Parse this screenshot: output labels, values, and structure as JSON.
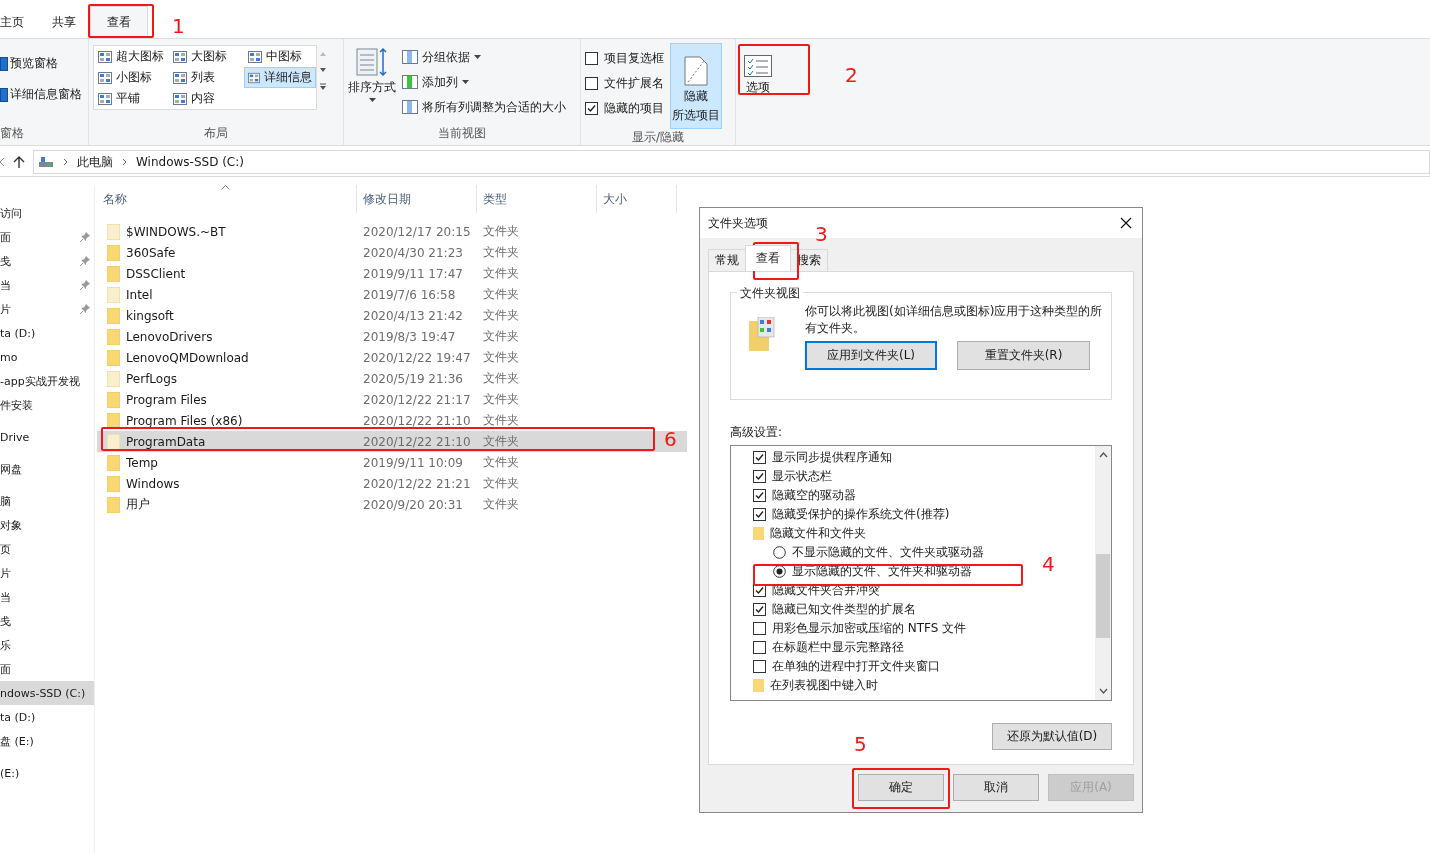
{
  "ribbon_tabs": [
    {
      "label": "主页",
      "selected": false
    },
    {
      "label": "共享",
      "selected": false
    },
    {
      "label": "查看",
      "selected": true
    }
  ],
  "ribbon": {
    "pane_group": {
      "label": "窗格",
      "items": [
        "预览窗格",
        "详细信息窗格"
      ]
    },
    "layout_group": {
      "label": "布局",
      "options": [
        {
          "label": "超大图标",
          "selected": false
        },
        {
          "label": "大图标",
          "selected": false
        },
        {
          "label": "中图标",
          "selected": false
        },
        {
          "label": "小图标",
          "selected": false
        },
        {
          "label": "列表",
          "selected": false
        },
        {
          "label": "详细信息",
          "selected": true
        },
        {
          "label": "平铺",
          "selected": false
        },
        {
          "label": "内容",
          "selected": false
        }
      ]
    },
    "current_view_group": {
      "label": "当前视图",
      "sort_button": "排序方式",
      "commands": [
        {
          "label": "分组依据",
          "dropdown": true
        },
        {
          "label": "添加列",
          "dropdown": true
        },
        {
          "label": "将所有列调整为合适的大小",
          "dropdown": false
        }
      ]
    },
    "show_hide_group": {
      "label": "显示/隐藏",
      "checkboxes": [
        {
          "label": "项目复选框",
          "checked": false
        },
        {
          "label": "文件扩展名",
          "checked": false
        },
        {
          "label": "隐藏的项目",
          "checked": true
        }
      ],
      "hide_selected_button": [
        "隐藏",
        "所选项目"
      ]
    },
    "options_button": "选项"
  },
  "address_bar": {
    "path": [
      "此电脑",
      "Windows-SSD (C:)"
    ]
  },
  "navigation": {
    "sections": [
      {
        "items": [
          {
            "label": "访问",
            "pinned": false,
            "selected": false
          },
          {
            "label": "面",
            "pinned": true,
            "selected": false
          },
          {
            "label": "戋",
            "pinned": true,
            "selected": false
          },
          {
            "label": "当",
            "pinned": true,
            "selected": false
          },
          {
            "label": "片",
            "pinned": true,
            "selected": false
          },
          {
            "label": "ta (D:)",
            "pinned": false,
            "selected": false
          },
          {
            "label": "mo",
            "pinned": false,
            "selected": false
          },
          {
            "label": "-app实战开发视",
            "pinned": false,
            "selected": false
          },
          {
            "label": "件安装",
            "pinned": false,
            "selected": false
          }
        ]
      },
      {
        "items": [
          {
            "label": "Drive",
            "pinned": false,
            "selected": false
          }
        ]
      },
      {
        "items": [
          {
            "label": "网盘",
            "pinned": false,
            "selected": false
          }
        ]
      },
      {
        "items": [
          {
            "label": "脑",
            "pinned": false,
            "selected": false
          },
          {
            "label": "对象",
            "pinned": false,
            "selected": false
          },
          {
            "label": "页",
            "pinned": false,
            "selected": false
          },
          {
            "label": "片",
            "pinned": false,
            "selected": false
          },
          {
            "label": "当",
            "pinned": false,
            "selected": false
          },
          {
            "label": "戋",
            "pinned": false,
            "selected": false
          },
          {
            "label": "乐",
            "pinned": false,
            "selected": false
          },
          {
            "label": "面",
            "pinned": false,
            "selected": false
          },
          {
            "label": "ndows-SSD (C:)",
            "pinned": false,
            "selected": true
          },
          {
            "label": "ta (D:)",
            "pinned": false,
            "selected": false
          },
          {
            "label": "盘 (E:)",
            "pinned": false,
            "selected": false
          }
        ]
      },
      {
        "items": [
          {
            "label": "(E:)",
            "pinned": false,
            "selected": false
          }
        ]
      }
    ]
  },
  "file_list": {
    "columns": [
      "名称",
      "修改日期",
      "类型",
      "大小"
    ],
    "rows": [
      {
        "name": "$WINDOWS.~BT",
        "modified": "2020/12/17 20:15",
        "type": "文件夹",
        "hidden": true,
        "selected": false
      },
      {
        "name": "360Safe",
        "modified": "2020/4/30 21:23",
        "type": "文件夹",
        "hidden": false,
        "selected": false
      },
      {
        "name": "DSSClient",
        "modified": "2019/9/11 17:47",
        "type": "文件夹",
        "hidden": false,
        "selected": false
      },
      {
        "name": "Intel",
        "modified": "2019/7/6 16:58",
        "type": "文件夹",
        "hidden": true,
        "selected": false
      },
      {
        "name": "kingsoft",
        "modified": "2020/4/13 21:42",
        "type": "文件夹",
        "hidden": false,
        "selected": false
      },
      {
        "name": "LenovoDrivers",
        "modified": "2019/8/3 19:47",
        "type": "文件夹",
        "hidden": false,
        "selected": false
      },
      {
        "name": "LenovoQMDownload",
        "modified": "2020/12/22 19:47",
        "type": "文件夹",
        "hidden": false,
        "selected": false
      },
      {
        "name": "PerfLogs",
        "modified": "2020/5/19 21:36",
        "type": "文件夹",
        "hidden": true,
        "selected": false
      },
      {
        "name": "Program Files",
        "modified": "2020/12/22 21:17",
        "type": "文件夹",
        "hidden": false,
        "selected": false
      },
      {
        "name": "Program Files (x86)",
        "modified": "2020/12/22 21:10",
        "type": "文件夹",
        "hidden": false,
        "selected": false
      },
      {
        "name": "ProgramData",
        "modified": "2020/12/22 21:10",
        "type": "文件夹",
        "hidden": true,
        "selected": true
      },
      {
        "name": "Temp",
        "modified": "2019/9/11 10:09",
        "type": "文件夹",
        "hidden": false,
        "selected": false
      },
      {
        "name": "Windows",
        "modified": "2020/12/22 21:21",
        "type": "文件夹",
        "hidden": false,
        "selected": false
      },
      {
        "name": "用户",
        "modified": "2020/9/20 20:31",
        "type": "文件夹",
        "hidden": false,
        "selected": false
      }
    ]
  },
  "dialog": {
    "title": "文件夹选项",
    "tabs": [
      {
        "label": "常规",
        "selected": false
      },
      {
        "label": "查看",
        "selected": true
      },
      {
        "label": "搜索",
        "selected": false
      }
    ],
    "folder_views": {
      "title": "文件夹视图",
      "description": "你可以将此视图(如详细信息或图标)应用于这种类型的所有文件夹。",
      "buttons": [
        {
          "label": "应用到文件夹(L)",
          "focused": true
        },
        {
          "label": "重置文件夹(R)",
          "focused": false
        }
      ]
    },
    "advanced_label": "高级设置:",
    "settings": [
      {
        "kind": "checkbox",
        "label": "显示同步提供程序通知",
        "checked": true
      },
      {
        "kind": "checkbox",
        "label": "显示状态栏",
        "checked": true
      },
      {
        "kind": "checkbox",
        "label": "隐藏空的驱动器",
        "checked": true
      },
      {
        "kind": "checkbox",
        "label": "隐藏受保护的操作系统文件(推荐)",
        "checked": true
      },
      {
        "kind": "folder",
        "label": "隐藏文件和文件夹",
        "children": [
          {
            "kind": "radio",
            "label": "不显示隐藏的文件、文件夹或驱动器",
            "selected": false
          },
          {
            "kind": "radio",
            "label": "显示隐藏的文件、文件夹和驱动器",
            "selected": true
          }
        ]
      },
      {
        "kind": "checkbox",
        "label": "隐藏文件夹合并冲突",
        "checked": true
      },
      {
        "kind": "checkbox",
        "label": "隐藏已知文件类型的扩展名",
        "checked": true
      },
      {
        "kind": "checkbox",
        "label": "用彩色显示加密或压缩的 NTFS 文件",
        "checked": false
      },
      {
        "kind": "checkbox",
        "label": "在标题栏中显示完整路径",
        "checked": false
      },
      {
        "kind": "checkbox",
        "label": "在单独的进程中打开文件夹窗口",
        "checked": false
      },
      {
        "kind": "folder",
        "label": "在列表视图中键入时"
      }
    ],
    "restore_button": "还原为默认值(D)",
    "buttons": [
      {
        "label": "确定",
        "disabled": false
      },
      {
        "label": "取消",
        "disabled": false
      },
      {
        "label": "应用(A)",
        "disabled": true
      }
    ]
  },
  "annotations": [
    {
      "label": "1"
    },
    {
      "label": "2"
    },
    {
      "label": "3"
    },
    {
      "label": "4"
    },
    {
      "label": "5"
    },
    {
      "label": "6"
    }
  ]
}
